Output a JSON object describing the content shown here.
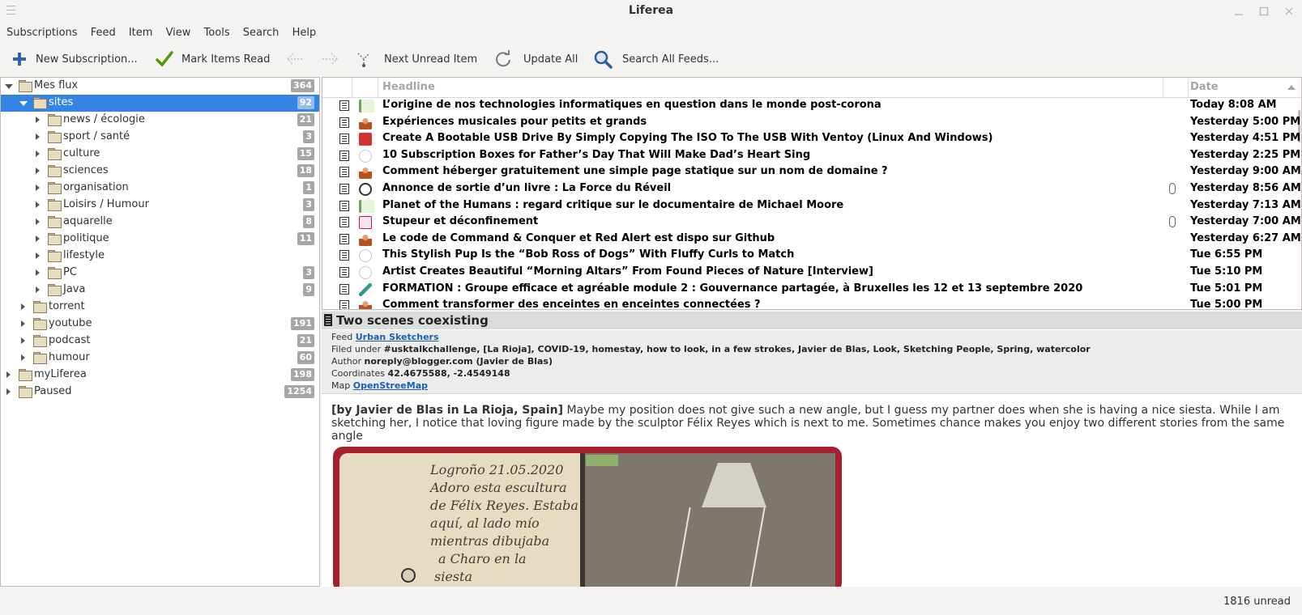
{
  "window": {
    "title": "Liferea"
  },
  "menu": [
    "Subscriptions",
    "Feed",
    "Item",
    "View",
    "Tools",
    "Search",
    "Help"
  ],
  "toolbar": {
    "new_subscription": "New Subscription...",
    "mark_read": "Mark Items Read",
    "next_unread": "Next Unread Item",
    "update_all": "Update All",
    "search_all": "Search All Feeds..."
  },
  "tree": [
    {
      "label": "Mes flux",
      "count": "364"
    },
    {
      "label": "sites",
      "count": "92"
    },
    {
      "label": "news / écologie",
      "count": "21"
    },
    {
      "label": "sport / santé",
      "count": "3"
    },
    {
      "label": "culture",
      "count": "15"
    },
    {
      "label": "sciences",
      "count": "18"
    },
    {
      "label": "organisation",
      "count": "1"
    },
    {
      "label": "Loisirs / Humour",
      "count": "3"
    },
    {
      "label": "aquarelle",
      "count": "8"
    },
    {
      "label": "politique",
      "count": "11"
    },
    {
      "label": "lifestyle",
      "count": ""
    },
    {
      "label": "PC",
      "count": "3"
    },
    {
      "label": "Java",
      "count": "9"
    },
    {
      "label": "torrent",
      "count": ""
    },
    {
      "label": "youtube",
      "count": "191"
    },
    {
      "label": "podcast",
      "count": "21"
    },
    {
      "label": "humour",
      "count": "60"
    },
    {
      "label": "myLiferea",
      "count": "198"
    },
    {
      "label": "Paused",
      "count": "1254"
    }
  ],
  "list": {
    "col_headline": "Headline",
    "col_date": "Date",
    "items": [
      {
        "headline": "L’origine de nos technologies informatiques en question dans le monde post-corona",
        "date": "Today 8:08 AM",
        "fav": "green-leaf"
      },
      {
        "headline": "Expériences musicales pour petits et grands",
        "date": "Yesterday 5:00 PM",
        "fav": "avatar"
      },
      {
        "headline": "Create A Bootable USB Drive By Simply Copying The ISO To The USB With Ventoy (Linux And Windows)",
        "date": "Yesterday 4:51 PM",
        "fav": "code-red"
      },
      {
        "headline": "10 Subscription Boxes for Father’s Day That Will Make Dad’s Heart Sing",
        "date": "Yesterday 2:25 PM",
        "fav": "grey-circle"
      },
      {
        "headline": "Comment héberger gratuitement une simple page statique sur un nom de domaine ?",
        "date": "Yesterday 9:00 AM",
        "fav": "avatar"
      },
      {
        "headline": "Annonce de sortie d’un livre : La Force du Réveil",
        "date": "Yesterday 8:56 AM",
        "fav": "dark-circle",
        "attachment": true
      },
      {
        "headline": "Planet of the Humans : regard critique sur le documentaire de Michael Moore",
        "date": "Yesterday 7:13 AM",
        "fav": "green-leaf"
      },
      {
        "headline": "Stupeur et déconfinement",
        "date": "Yesterday 7:00 AM",
        "fav": "pink-logo",
        "attachment": true
      },
      {
        "headline": "Le code de Command & Conquer et Red Alert est dispo sur Github",
        "date": "Yesterday 6:27 AM",
        "fav": "avatar"
      },
      {
        "headline": "This Stylish Pup Is the “Bob Ross of Dogs” With Fluffy Curls to Match",
        "date": "Tue 6:55 PM",
        "fav": "grey-circle"
      },
      {
        "headline": "Artist Creates Beautiful “Morning Altars” From Found Pieces of Nature [Interview]",
        "date": "Tue 5:10 PM",
        "fav": "grey-circle"
      },
      {
        "headline": "FORMATION : Groupe efficace et agréable module 2 : Gouvernance partagée, à Bruxelles les 12 et 13 septembre 2020",
        "date": "Tue 5:01 PM",
        "fav": "teal-leaf"
      },
      {
        "headline": "Comment transformer des enceintes en enceintes connectées ?",
        "date": "Tue 5:00 PM",
        "fav": "avatar"
      }
    ]
  },
  "detail": {
    "title": "Two scenes coexisting",
    "feed_label": "Feed",
    "feed": "Urban Sketchers",
    "filed_label": "Filed under",
    "filed": "#usktalkchallenge, [La Rioja], COVID-19, homestay, how to look, in a few strokes, Javier de Blas, Look, Sketching People, Spring, watercolor",
    "author_label": "Author",
    "author": "noreply@blogger.com (Javier de Blas)",
    "coords_label": "Coordinates",
    "coords": "42.4675588, -2.4549148",
    "map_label": "Map",
    "map": "OpenStreeMap",
    "byline": "[by Javier de Blas in La Rioja, Spain]",
    "body": " Maybe my position does not give such a new angle, but I guess my partner does when she is having a nice siesta. While I am sketching her, I notice that loving figure made by the sculptor Félix Reyes which is next to me. Sometimes chance makes you enjoy two different stories from the same angle",
    "handwriting": [
      "Logroño 21.05.2020",
      "Adoro esta escultura",
      "de Félix Reyes. Estaba",
      "aquí, al lado mío",
      "mientras dibujaba",
      "a Charo en la",
      "siesta"
    ]
  },
  "status": {
    "unread": "1816 unread"
  },
  "colors": {
    "selection": "#3584e4",
    "badge": "#a6a6a6",
    "link": "#1c5fb0"
  }
}
